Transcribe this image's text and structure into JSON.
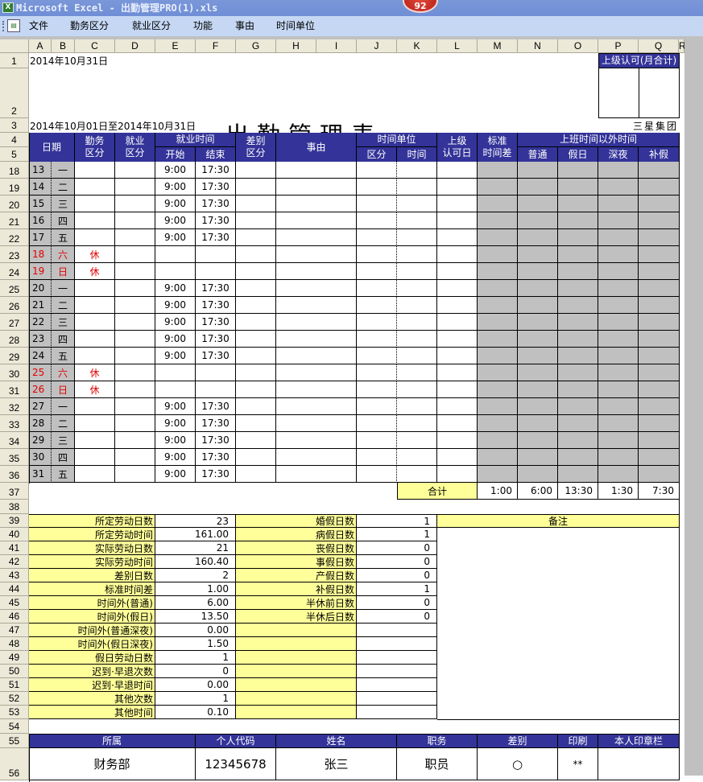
{
  "window": {
    "title": "Microsoft Excel - 出勤管理PRO(1).xls",
    "badge_count": "92",
    "app_icon": "excel-icon"
  },
  "menu": {
    "doc_icon": "workbook-icon",
    "items": [
      "文件",
      "勤务区分",
      "就业区分",
      "功能",
      "事由",
      "时间单位"
    ]
  },
  "columns": [
    "A",
    "B",
    "C",
    "D",
    "E",
    "F",
    "G",
    "H",
    "I",
    "J",
    "K",
    "L",
    "M",
    "N",
    "O",
    "P",
    "Q",
    "R"
  ],
  "header": {
    "date": "2014年10月31日",
    "title": "出勤管理表",
    "period": "2014年10月01日至2014年10月31日",
    "company": "三星集团",
    "approval_box_label": "上级认可(月合计)"
  },
  "table_headers": {
    "date": "日期",
    "duty_type_1": "勤务",
    "duty_type_2": "区分",
    "employment_type_1": "就业",
    "employment_type_2": "区分",
    "work_time": "就业时间",
    "start": "开始",
    "end": "结束",
    "diff_type_1": "差别",
    "diff_type_2": "区分",
    "reason": "事由",
    "time_unit": "时间单位",
    "tu_type": "区分",
    "tu_time": "时间",
    "approval_1": "上级",
    "approval_2": "认可日",
    "std_diff_1": "标准",
    "std_diff_2": "时间差",
    "overtime": "上班时间以外时间",
    "ot_normal": "普通",
    "ot_holiday": "假日",
    "ot_night": "深夜",
    "ot_comp": "补假"
  },
  "rows": [
    {
      "row": "18",
      "day": "13",
      "weekday": "一",
      "duty": "",
      "start": "9:00",
      "end": "17:30",
      "holiday": false
    },
    {
      "row": "19",
      "day": "14",
      "weekday": "二",
      "duty": "",
      "start": "9:00",
      "end": "17:30",
      "holiday": false
    },
    {
      "row": "20",
      "day": "15",
      "weekday": "三",
      "duty": "",
      "start": "9:00",
      "end": "17:30",
      "holiday": false
    },
    {
      "row": "21",
      "day": "16",
      "weekday": "四",
      "duty": "",
      "start": "9:00",
      "end": "17:30",
      "holiday": false
    },
    {
      "row": "22",
      "day": "17",
      "weekday": "五",
      "duty": "",
      "start": "9:00",
      "end": "17:30",
      "holiday": false
    },
    {
      "row": "23",
      "day": "18",
      "weekday": "六",
      "duty": "休",
      "start": "",
      "end": "",
      "holiday": true
    },
    {
      "row": "24",
      "day": "19",
      "weekday": "日",
      "duty": "休",
      "start": "",
      "end": "",
      "holiday": true
    },
    {
      "row": "25",
      "day": "20",
      "weekday": "一",
      "duty": "",
      "start": "9:00",
      "end": "17:30",
      "holiday": false
    },
    {
      "row": "26",
      "day": "21",
      "weekday": "二",
      "duty": "",
      "start": "9:00",
      "end": "17:30",
      "holiday": false
    },
    {
      "row": "27",
      "day": "22",
      "weekday": "三",
      "duty": "",
      "start": "9:00",
      "end": "17:30",
      "holiday": false
    },
    {
      "row": "28",
      "day": "23",
      "weekday": "四",
      "duty": "",
      "start": "9:00",
      "end": "17:30",
      "holiday": false
    },
    {
      "row": "29",
      "day": "24",
      "weekday": "五",
      "duty": "",
      "start": "9:00",
      "end": "17:30",
      "holiday": false
    },
    {
      "row": "30",
      "day": "25",
      "weekday": "六",
      "duty": "休",
      "start": "",
      "end": "",
      "holiday": true
    },
    {
      "row": "31",
      "day": "26",
      "weekday": "日",
      "duty": "休",
      "start": "",
      "end": "",
      "holiday": true
    },
    {
      "row": "32",
      "day": "27",
      "weekday": "一",
      "duty": "",
      "start": "9:00",
      "end": "17:30",
      "holiday": false
    },
    {
      "row": "33",
      "day": "28",
      "weekday": "二",
      "duty": "",
      "start": "9:00",
      "end": "17:30",
      "holiday": false
    },
    {
      "row": "34",
      "day": "29",
      "weekday": "三",
      "duty": "",
      "start": "9:00",
      "end": "17:30",
      "holiday": false
    },
    {
      "row": "35",
      "day": "30",
      "weekday": "四",
      "duty": "",
      "start": "9:00",
      "end": "17:30",
      "holiday": false
    },
    {
      "row": "36",
      "day": "31",
      "weekday": "五",
      "duty": "",
      "start": "9:00",
      "end": "17:30",
      "holiday": false
    }
  ],
  "totals": {
    "label": "合计",
    "values": [
      "1:00",
      "6:00",
      "13:30",
      "1:30",
      "7:30"
    ]
  },
  "summary_left": [
    {
      "row": "39",
      "label": "所定劳动日数",
      "value": "23"
    },
    {
      "row": "40",
      "label": "所定劳动时间",
      "value": "161.00"
    },
    {
      "row": "41",
      "label": "实际劳动日数",
      "value": "21"
    },
    {
      "row": "42",
      "label": "实际劳动时间",
      "value": "160.40"
    },
    {
      "row": "43",
      "label": "差别日数",
      "value": "2"
    },
    {
      "row": "44",
      "label": "标准时间差",
      "value": "1.00"
    },
    {
      "row": "45",
      "label": "时间外(普通)",
      "value": "6.00"
    },
    {
      "row": "46",
      "label": "时间外(假日)",
      "value": "13.50"
    },
    {
      "row": "47",
      "label": "时间外(普通深夜)",
      "value": "0.00"
    },
    {
      "row": "48",
      "label": "时间外(假日深夜)",
      "value": "1.50"
    },
    {
      "row": "49",
      "label": "假日劳动日数",
      "value": "1"
    },
    {
      "row": "50",
      "label": "迟到·早退次数",
      "value": "0"
    },
    {
      "row": "51",
      "label": "迟到·早退时间",
      "value": "0.00"
    },
    {
      "row": "52",
      "label": "其他次数",
      "value": "1"
    },
    {
      "row": "53",
      "label": "其他时间",
      "value": "0.10"
    }
  ],
  "summary_right": [
    {
      "label": "婚假日数",
      "value": "1"
    },
    {
      "label": "病假日数",
      "value": "1"
    },
    {
      "label": "丧假日数",
      "value": "0"
    },
    {
      "label": "事假日数",
      "value": "0"
    },
    {
      "label": "产假日数",
      "value": "0"
    },
    {
      "label": "补假日数",
      "value": "1"
    },
    {
      "label": "半休前日数",
      "value": "0"
    },
    {
      "label": "半休后日数",
      "value": "0"
    },
    {
      "label": "",
      "value": ""
    },
    {
      "label": "",
      "value": ""
    },
    {
      "label": "",
      "value": ""
    },
    {
      "label": "",
      "value": ""
    },
    {
      "label": "",
      "value": ""
    },
    {
      "label": "",
      "value": ""
    },
    {
      "label": "",
      "value": ""
    }
  ],
  "notes_label": "备注",
  "footer": {
    "headers": [
      "所属",
      "个人代码",
      "姓名",
      "职务",
      "差别",
      "印刷",
      "本人印章栏"
    ],
    "values": [
      "财务部",
      "12345678",
      "张三",
      "职员",
      "○",
      "**",
      ""
    ]
  },
  "extra_rows": [
    "1",
    "2",
    "3",
    "4",
    "5",
    "37",
    "38",
    "54",
    "55",
    "56"
  ]
}
